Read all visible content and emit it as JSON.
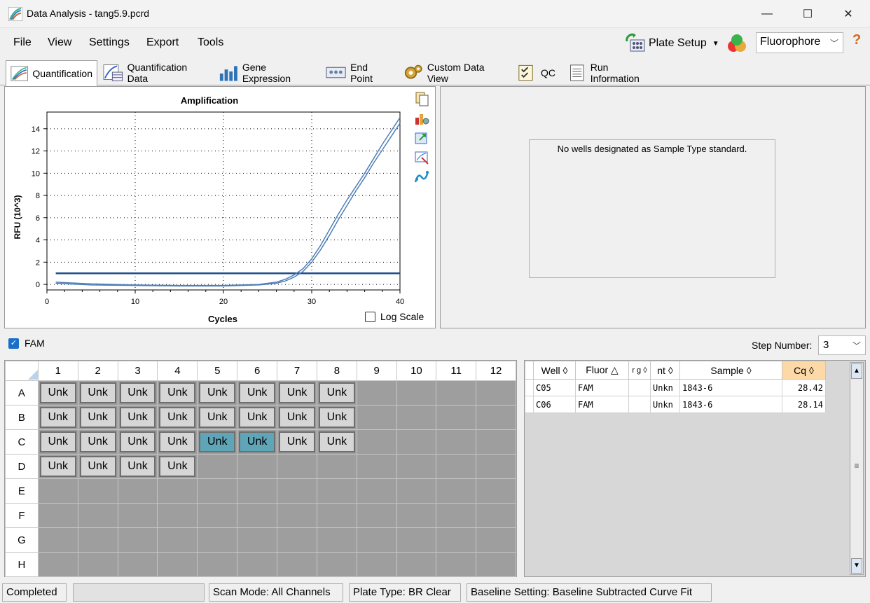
{
  "window": {
    "title": "Data Analysis - tang5.9.pcrd",
    "minimize": "—",
    "maximize": "☐",
    "close": "✕"
  },
  "menu": {
    "file": "File",
    "view": "View",
    "settings": "Settings",
    "export": "Export",
    "tools": "Tools",
    "plate_setup": "Plate Setup",
    "fluorophore": "Fluorophore",
    "help": "?"
  },
  "tabs": [
    {
      "label": "Quantification",
      "active": true
    },
    {
      "label": "Quantification Data"
    },
    {
      "label": "Gene Expression"
    },
    {
      "label": "End Point"
    },
    {
      "label": "Custom Data View"
    },
    {
      "label": "QC"
    },
    {
      "label": "Run Information"
    }
  ],
  "chart": {
    "log_scale_label": "Log Scale"
  },
  "chart_data": {
    "type": "line",
    "title": "Amplification",
    "xlabel": "Cycles",
    "ylabel": "RFU (10^3)",
    "xlim": [
      0,
      40
    ],
    "ylim": [
      -0.5,
      15.5
    ],
    "xticks": [
      0,
      10,
      20,
      30,
      40
    ],
    "yticks": [
      0,
      2,
      4,
      6,
      8,
      10,
      12,
      14
    ],
    "grid": true,
    "threshold": 1.0,
    "series": [
      {
        "x": [
          1,
          5,
          10,
          15,
          20,
          24,
          26,
          27,
          28,
          29,
          30,
          31,
          32,
          33,
          34,
          35,
          36,
          37,
          38,
          39,
          40
        ],
        "values": [
          0.2,
          0.05,
          -0.05,
          -0.1,
          -0.1,
          0.0,
          0.2,
          0.45,
          0.85,
          1.4,
          2.3,
          3.5,
          4.9,
          6.3,
          7.6,
          8.8,
          10.0,
          11.3,
          12.6,
          13.8,
          15.0
        ]
      },
      {
        "x": [
          1,
          5,
          10,
          15,
          20,
          24,
          26,
          27,
          28,
          29,
          30,
          31,
          32,
          33,
          34,
          35,
          36,
          37,
          38,
          39,
          40
        ],
        "values": [
          0.1,
          -0.05,
          -0.1,
          -0.15,
          -0.15,
          -0.05,
          0.1,
          0.3,
          0.65,
          1.15,
          2.0,
          3.1,
          4.4,
          5.8,
          7.1,
          8.4,
          9.6,
          10.9,
          12.1,
          13.3,
          14.5
        ]
      }
    ]
  },
  "standard_curve": {
    "message": "No wells designated as Sample Type standard."
  },
  "fluor_bar": {
    "fam_label": "FAM",
    "step_label": "Step Number:",
    "step_value": "3"
  },
  "plate": {
    "columns": [
      "1",
      "2",
      "3",
      "4",
      "5",
      "6",
      "7",
      "8",
      "9",
      "10",
      "11",
      "12"
    ],
    "rows": [
      "A",
      "B",
      "C",
      "D",
      "E",
      "F",
      "G",
      "H"
    ],
    "well_label": "Unk",
    "filled": {
      "A": [
        1,
        2,
        3,
        4,
        5,
        6,
        7,
        8
      ],
      "B": [
        1,
        2,
        3,
        4,
        5,
        6,
        7,
        8
      ],
      "C": [
        1,
        2,
        3,
        4,
        5,
        6,
        7,
        8
      ],
      "D": [
        1,
        2,
        3,
        4
      ]
    },
    "selected": [
      "C5",
      "C6"
    ]
  },
  "results": {
    "headers": [
      "Well",
      "Fluor",
      "r\ng",
      "nt",
      "Sample",
      "Cq"
    ],
    "rows": [
      {
        "well": "C05",
        "fluor": "FAM",
        "target": "",
        "content": "Unkn",
        "sample": "1843-6",
        "cq": "28.42"
      },
      {
        "well": "C06",
        "fluor": "FAM",
        "target": "",
        "content": "Unkn",
        "sample": "1843-6",
        "cq": "28.14"
      }
    ]
  },
  "status": {
    "state": "Completed",
    "scan_mode": "Scan Mode: All Channels",
    "plate_type": "Plate Type: BR Clear",
    "baseline": "Baseline Setting: Baseline Subtracted Curve Fit"
  },
  "colors": {
    "curve": "#4f7fb8",
    "threshold": "#1f4e8c",
    "selected_well": "#5ea5b8",
    "cq_header": "#fcd9a7"
  }
}
